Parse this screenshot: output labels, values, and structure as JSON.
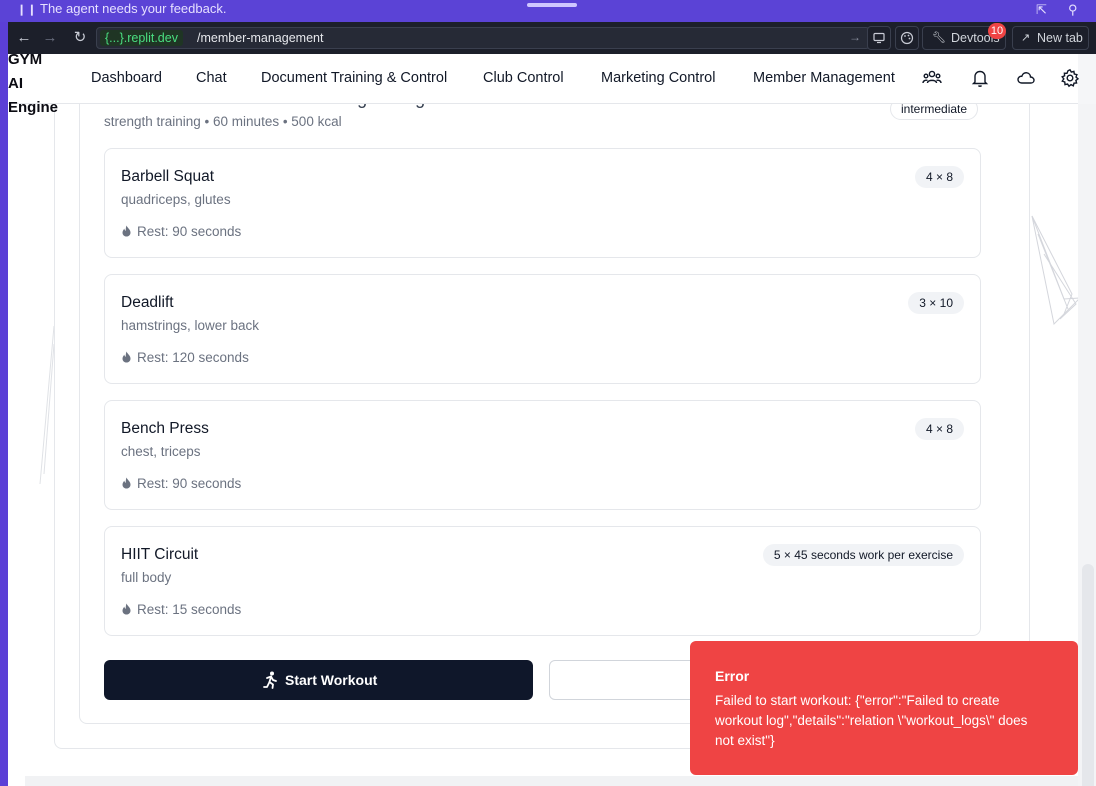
{
  "agent_bar": {
    "message": "The agent needs your feedback."
  },
  "browser": {
    "url_host": "{...}.replit.dev",
    "url_path": "/member-management",
    "devtools_label": "Devtools",
    "devtools_badge": "10",
    "new_tab_label": "New tab"
  },
  "app": {
    "logo_lines": [
      "GYM",
      "AI",
      "Engine"
    ],
    "nav": [
      "Dashboard",
      "Chat",
      "Document Training & Control",
      "Club Control",
      "Marketing Control",
      "Member Management"
    ]
  },
  "program": {
    "title": "Intermediate Muscle Gain Strength Program",
    "meta": "strength training • 60 minutes • 500 kcal",
    "level": "intermediate"
  },
  "exercises": [
    {
      "name": "Barbell Squat",
      "muscles": "quadriceps, glutes",
      "rest": "Rest: 90 seconds",
      "sets": "4 × 8"
    },
    {
      "name": "Deadlift",
      "muscles": "hamstrings, lower back",
      "rest": "Rest: 120 seconds",
      "sets": "3 × 10"
    },
    {
      "name": "Bench Press",
      "muscles": "chest, triceps",
      "rest": "Rest: 90 seconds",
      "sets": "4 × 8"
    },
    {
      "name": "HIIT Circuit",
      "muscles": "full body",
      "rest": "Rest: 15 seconds",
      "sets": "5 × 45 seconds work per exercise"
    }
  ],
  "actions": {
    "start_label": "Start Workout"
  },
  "toast": {
    "title": "Error",
    "body": "Failed to start workout: {\"error\":\"Failed to create workout log\",\"details\":\"relation \\\"workout_logs\\\" does not exist\"}"
  },
  "colors": {
    "accent": "#5b43d6",
    "error": "#ef4444",
    "primary_button": "#0f172a"
  }
}
